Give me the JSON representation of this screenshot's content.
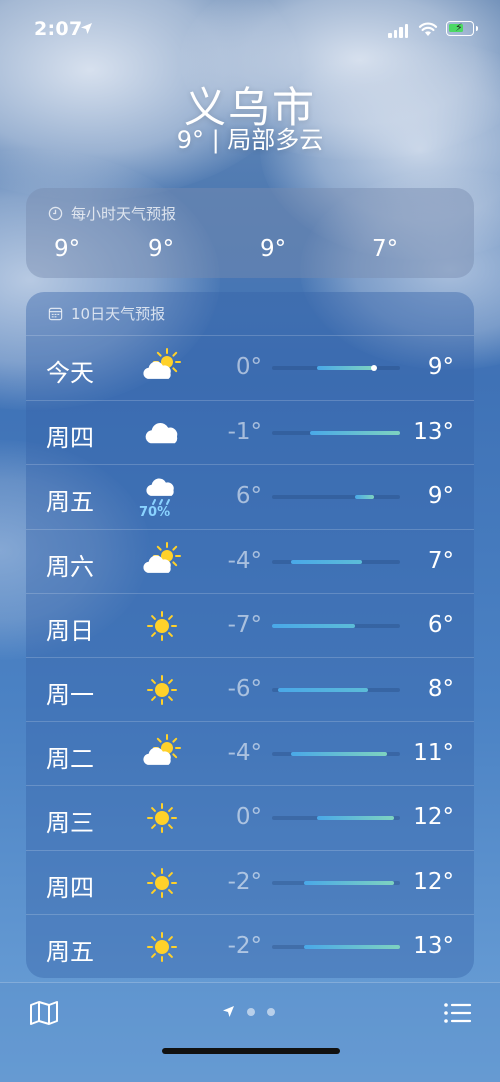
{
  "status_bar": {
    "time": "2:07"
  },
  "header": {
    "city": "义乌市",
    "summary": "9° | 局部多云"
  },
  "hourly": {
    "title": "每小时天气预报",
    "temps": [
      "9°",
      "9°",
      "9°",
      "7°"
    ]
  },
  "daily": {
    "title": "10日天气预报",
    "scale": {
      "min": -7,
      "max": 13
    },
    "current_temp": 9,
    "days": [
      {
        "name": "今天",
        "icon": "partly-sunny-icon",
        "low": "0°",
        "high": "9°",
        "lo_val": 0,
        "hi_val": 9,
        "precip": ""
      },
      {
        "name": "周四",
        "icon": "cloud-icon",
        "low": "-1°",
        "high": "13°",
        "lo_val": -1,
        "hi_val": 13,
        "precip": ""
      },
      {
        "name": "周五",
        "icon": "rain-icon",
        "low": "6°",
        "high": "9°",
        "lo_val": 6,
        "hi_val": 9,
        "precip": "70%"
      },
      {
        "name": "周六",
        "icon": "partly-sunny-icon",
        "low": "-4°",
        "high": "7°",
        "lo_val": -4,
        "hi_val": 7,
        "precip": ""
      },
      {
        "name": "周日",
        "icon": "sun-icon",
        "low": "-7°",
        "high": "6°",
        "lo_val": -7,
        "hi_val": 6,
        "precip": ""
      },
      {
        "name": "周一",
        "icon": "sun-icon",
        "low": "-6°",
        "high": "8°",
        "lo_val": -6,
        "hi_val": 8,
        "precip": ""
      },
      {
        "name": "周二",
        "icon": "partly-sunny-icon",
        "low": "-4°",
        "high": "11°",
        "lo_val": -4,
        "hi_val": 11,
        "precip": ""
      },
      {
        "name": "周三",
        "icon": "sun-icon",
        "low": "0°",
        "high": "12°",
        "lo_val": 0,
        "hi_val": 12,
        "precip": ""
      },
      {
        "name": "周四",
        "icon": "sun-icon",
        "low": "-2°",
        "high": "12°",
        "lo_val": -2,
        "hi_val": 12,
        "precip": ""
      },
      {
        "name": "周五",
        "icon": "sun-icon",
        "low": "-2°",
        "high": "13°",
        "lo_val": -2,
        "hi_val": 13,
        "precip": ""
      }
    ]
  },
  "bottom_bar": {
    "map_icon": "map-icon",
    "list_icon": "list-icon",
    "pages": 3,
    "active_page": 0
  },
  "colors": {
    "bar_cool": "#4aa8e8",
    "bar_warm": "#7ed3c0",
    "sun": "#ffd12a",
    "precip": "#8ad3ff"
  }
}
